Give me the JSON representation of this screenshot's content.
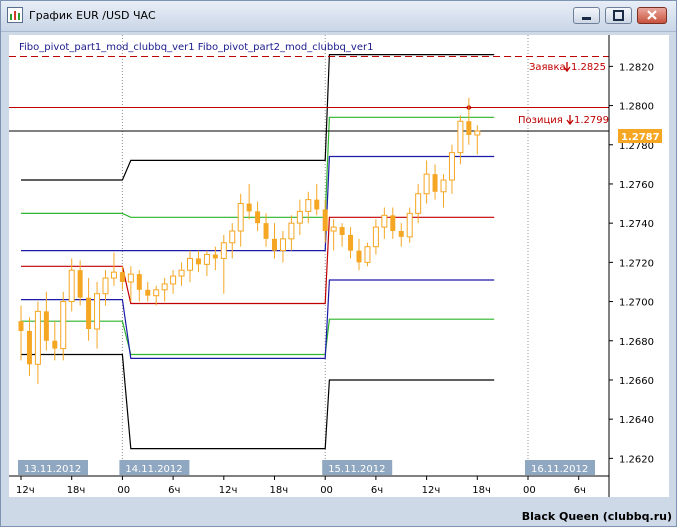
{
  "window": {
    "title": "График EUR /USD  ЧАС"
  },
  "indicators_label": "Fibo_pivot_part1_mod_clubbq_ver1 Fibo_pivot_part2_mod_clubbq_ver1",
  "order_labels": {
    "zayavka": "Заявка",
    "zayavka_price": "1.2825",
    "poziciya": "Позиция",
    "poziciya_price": "1.2799"
  },
  "current_price": "1.2787",
  "copyright": "Black Queen (clubbq.ru)",
  "colors": {
    "price_box": "#f5a623",
    "candle": "#f5a623",
    "order_red": "#c00000"
  },
  "chart_data": {
    "type": "candlestick",
    "y_ticks": [
      "1.2820",
      "1.2800",
      "1.2780",
      "1.2760",
      "1.2740",
      "1.2720",
      "1.2700",
      "1.2680",
      "1.2660",
      "1.2640",
      "1.2620"
    ],
    "y_tick_values": [
      1.282,
      1.28,
      1.278,
      1.276,
      1.274,
      1.272,
      1.27,
      1.268,
      1.266,
      1.264,
      1.262
    ],
    "ylim": [
      1.2611,
      1.2836
    ],
    "date_labels": [
      {
        "label": "13.11.2012",
        "hour": 0
      },
      {
        "label": "14.11.2012",
        "hour": 12
      },
      {
        "label": "15.11.2012",
        "hour": 36
      },
      {
        "label": "16.11.2012",
        "hour": 60
      }
    ],
    "x_tick_labels": [
      {
        "label": "12ч",
        "hour": 0
      },
      {
        "label": "18ч",
        "hour": 6
      },
      {
        "label": "00",
        "hour": 12
      },
      {
        "label": "6ч",
        "hour": 18
      },
      {
        "label": "12ч",
        "hour": 24
      },
      {
        "label": "18ч",
        "hour": 30
      },
      {
        "label": "00",
        "hour": 36
      },
      {
        "label": "6ч",
        "hour": 42
      },
      {
        "label": "12ч",
        "hour": 48
      },
      {
        "label": "18ч",
        "hour": 54
      },
      {
        "label": "00",
        "hour": 60
      },
      {
        "label": "6ч",
        "hour": 66
      }
    ],
    "day_separators_hour": [
      12,
      36,
      60
    ],
    "pivot_lines": [
      {
        "color": "#000000",
        "points": [
          [
            0,
            1.2673
          ],
          [
            12,
            1.2673
          ],
          [
            13,
            1.2625
          ],
          [
            36,
            1.2625
          ],
          [
            36.5,
            1.266
          ],
          [
            56,
            1.266
          ]
        ]
      },
      {
        "color": "#2db52d",
        "points": [
          [
            0,
            1.269
          ],
          [
            12,
            1.269
          ],
          [
            13,
            1.2673
          ],
          [
            36,
            1.2673
          ],
          [
            36.5,
            1.2691
          ],
          [
            56,
            1.2691
          ]
        ]
      },
      {
        "color": "#1a1aa8",
        "points": [
          [
            0,
            1.2701
          ],
          [
            12,
            1.2701
          ],
          [
            13,
            1.2671
          ],
          [
            36,
            1.2671
          ],
          [
            36.5,
            1.2711
          ],
          [
            56,
            1.2711
          ]
        ]
      },
      {
        "color": "#c00000",
        "points": [
          [
            0,
            1.2718
          ],
          [
            12,
            1.2718
          ],
          [
            13,
            1.2699
          ],
          [
            36,
            1.2699
          ],
          [
            36.5,
            1.2743
          ],
          [
            56,
            1.2743
          ]
        ]
      },
      {
        "color": "#1a1aa8",
        "points": [
          [
            0,
            1.2726
          ],
          [
            12,
            1.2726
          ],
          [
            13,
            1.2726
          ],
          [
            36,
            1.2726
          ],
          [
            36.5,
            1.2774
          ],
          [
            56,
            1.2774
          ]
        ]
      },
      {
        "color": "#2db52d",
        "points": [
          [
            0,
            1.2745
          ],
          [
            12,
            1.2745
          ],
          [
            13,
            1.2743
          ],
          [
            36,
            1.2743
          ],
          [
            36.5,
            1.2794
          ],
          [
            56,
            1.2794
          ]
        ]
      },
      {
        "color": "#000000",
        "points": [
          [
            0,
            1.2762
          ],
          [
            12,
            1.2762
          ],
          [
            13,
            1.2772
          ],
          [
            36,
            1.2772
          ],
          [
            36.5,
            1.2826
          ],
          [
            56,
            1.2826
          ]
        ]
      }
    ],
    "horizontal_levels": [
      {
        "price": 1.2825,
        "color": "#c00000",
        "style": "dashed"
      },
      {
        "price": 1.2799,
        "color": "#c00000",
        "style": "solid"
      },
      {
        "price": 1.2787,
        "color": "#000000",
        "style": "solid"
      }
    ],
    "candles": [
      [
        1.269,
        1.2698,
        1.267,
        1.2685
      ],
      [
        1.2685,
        1.2692,
        1.2662,
        1.2668
      ],
      [
        1.2668,
        1.27,
        1.2658,
        1.2695
      ],
      [
        1.2695,
        1.2705,
        1.2675,
        1.268
      ],
      [
        1.268,
        1.269,
        1.267,
        1.2676
      ],
      [
        1.2676,
        1.2705,
        1.267,
        1.27
      ],
      [
        1.27,
        1.2722,
        1.2695,
        1.2716
      ],
      [
        1.2716,
        1.2721,
        1.2698,
        1.2702
      ],
      [
        1.2702,
        1.2712,
        1.268,
        1.2686
      ],
      [
        1.2686,
        1.271,
        1.2676,
        1.2704
      ],
      [
        1.2704,
        1.2716,
        1.2698,
        1.2712
      ],
      [
        1.2712,
        1.2725,
        1.2708,
        1.2715
      ],
      [
        1.2715,
        1.2718,
        1.2706,
        1.271
      ],
      [
        1.271,
        1.2718,
        1.27,
        1.2714
      ],
      [
        1.2714,
        1.2716,
        1.27,
        1.2706
      ],
      [
        1.2706,
        1.271,
        1.27,
        1.2703
      ],
      [
        1.2703,
        1.2708,
        1.2698,
        1.2706
      ],
      [
        1.2706,
        1.2712,
        1.27,
        1.2709
      ],
      [
        1.2709,
        1.2716,
        1.2704,
        1.2713
      ],
      [
        1.2713,
        1.272,
        1.2708,
        1.2716
      ],
      [
        1.2716,
        1.2726,
        1.271,
        1.2722
      ],
      [
        1.2722,
        1.2726,
        1.2715,
        1.2719
      ],
      [
        1.2719,
        1.2726,
        1.2713,
        1.2724
      ],
      [
        1.2724,
        1.2728,
        1.2716,
        1.2722
      ],
      [
        1.2722,
        1.2734,
        1.2704,
        1.273
      ],
      [
        1.273,
        1.274,
        1.2722,
        1.2736
      ],
      [
        1.2736,
        1.2755,
        1.2728,
        1.275
      ],
      [
        1.275,
        1.276,
        1.2742,
        1.2746
      ],
      [
        1.2746,
        1.2751,
        1.2736,
        1.274
      ],
      [
        1.274,
        1.2745,
        1.2728,
        1.2732
      ],
      [
        1.2732,
        1.274,
        1.2722,
        1.2726
      ],
      [
        1.2726,
        1.2736,
        1.272,
        1.2732
      ],
      [
        1.2732,
        1.2744,
        1.2726,
        1.274
      ],
      [
        1.274,
        1.2752,
        1.2734,
        1.2746
      ],
      [
        1.2746,
        1.2756,
        1.274,
        1.2752
      ],
      [
        1.2752,
        1.276,
        1.2744,
        1.2747
      ],
      [
        1.2747,
        1.2752,
        1.273,
        1.2736
      ],
      [
        1.2736,
        1.2742,
        1.2726,
        1.2738
      ],
      [
        1.2738,
        1.274,
        1.2728,
        1.2734
      ],
      [
        1.2734,
        1.2738,
        1.2722,
        1.2726
      ],
      [
        1.2726,
        1.2732,
        1.2716,
        1.272
      ],
      [
        1.272,
        1.273,
        1.2718,
        1.2728
      ],
      [
        1.2728,
        1.2742,
        1.2724,
        1.2738
      ],
      [
        1.2738,
        1.2748,
        1.2732,
        1.2744
      ],
      [
        1.2744,
        1.2748,
        1.2732,
        1.2736
      ],
      [
        1.2736,
        1.274,
        1.2728,
        1.2733
      ],
      [
        1.2733,
        1.2748,
        1.273,
        1.2745
      ],
      [
        1.2745,
        1.276,
        1.274,
        1.2755
      ],
      [
        1.2755,
        1.2772,
        1.275,
        1.2765
      ],
      [
        1.2765,
        1.277,
        1.2752,
        1.2756
      ],
      [
        1.2756,
        1.2765,
        1.2748,
        1.2762
      ],
      [
        1.2762,
        1.278,
        1.2755,
        1.2776
      ],
      [
        1.2776,
        1.2795,
        1.277,
        1.2792
      ],
      [
        1.2792,
        1.2804,
        1.278,
        1.2785
      ],
      [
        1.2785,
        1.279,
        1.2775,
        1.2787
      ]
    ]
  }
}
